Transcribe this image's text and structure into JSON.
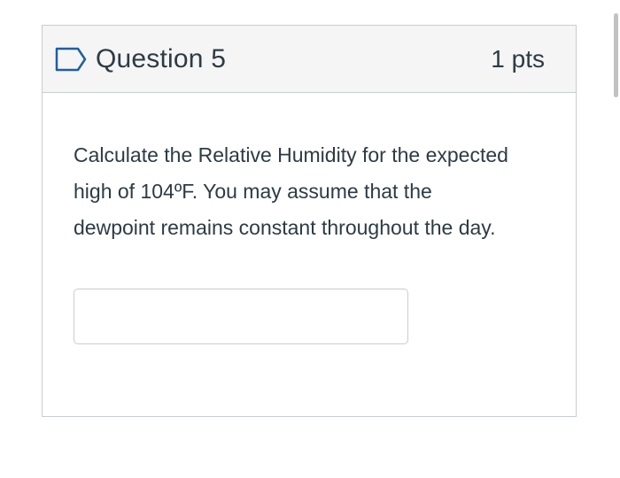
{
  "question": {
    "flag_icon": "bookmark-flag-outline-icon",
    "title": "Question 5",
    "points": "1 pts",
    "text": "Calculate the Relative Humidity for the expected high of 104ºF.  You may assume that the dewpoint remains constant throughout the day.",
    "answer": {
      "value": "",
      "placeholder": ""
    }
  },
  "colors": {
    "header_background": "#f5f5f5",
    "border": "#c7cdd1",
    "text": "#2d3b45",
    "flag_outline": "#1f5fa0"
  }
}
